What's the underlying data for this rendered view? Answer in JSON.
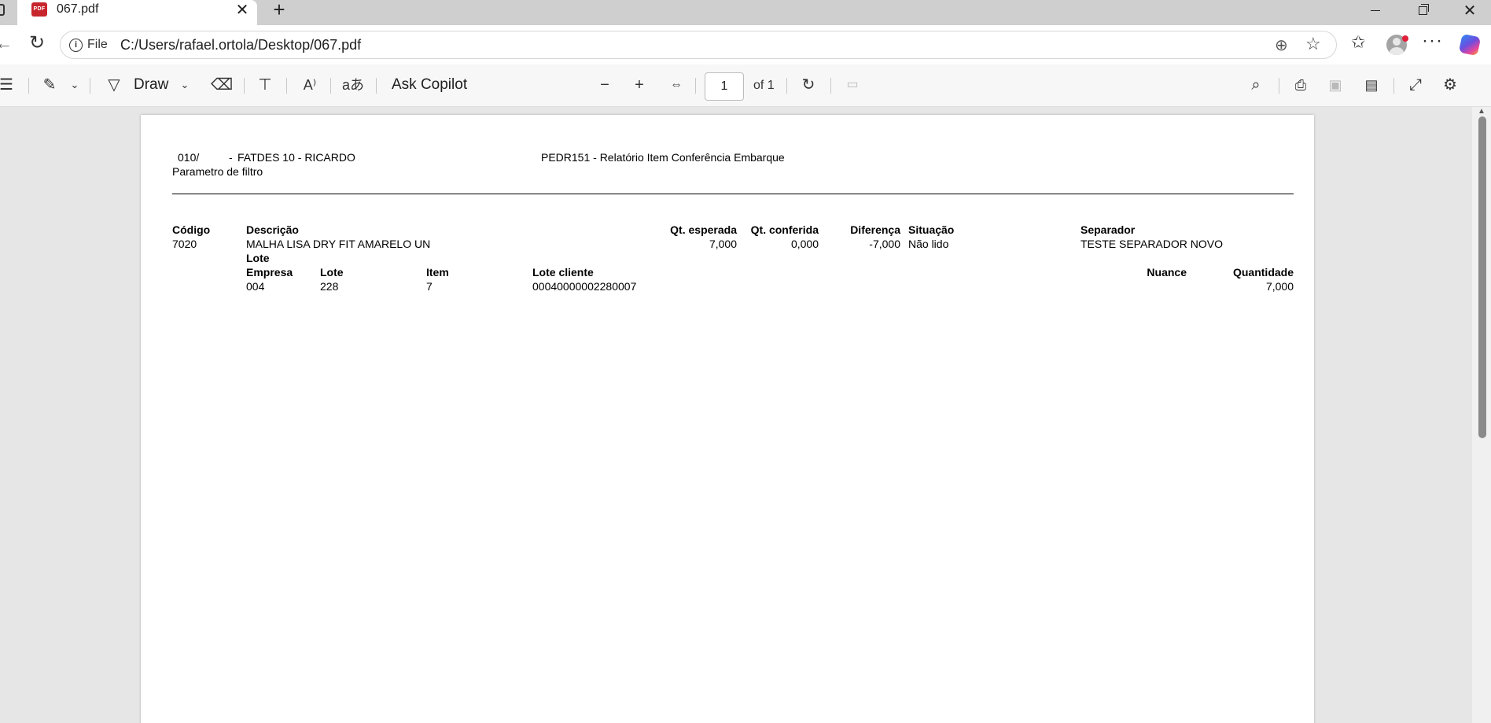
{
  "browser": {
    "tab_title": "067.pdf",
    "pdf_badge": "PDF",
    "file_label": "File",
    "url": "C:/Users/rafael.ortola/Desktop/067.pdf"
  },
  "toolbar": {
    "draw_label": "Draw",
    "ask_copilot_label": "Ask Copilot",
    "page_number": "1",
    "page_of": "of 1"
  },
  "report": {
    "header_code": "010/",
    "header_dash": "-",
    "header_name": "FATDES 10 - RICARDO",
    "report_title": "PEDR151 - Relatório Item Conferência Embarque",
    "filter_label": "Parametro de filtro",
    "columns": {
      "codigo": "Código",
      "descricao": "Descrição",
      "qt_esperada": "Qt. esperada",
      "qt_conferida": "Qt. conferida",
      "diferenca": "Diferença",
      "situacao": "Situação",
      "separador": "Separador"
    },
    "item": {
      "codigo": "7020",
      "descricao": "MALHA LISA DRY FIT AMARELO UN",
      "qt_esperada": "7,000",
      "qt_conferida": "0,000",
      "diferenca": "-7,000",
      "situacao": "Não lido",
      "separador": "TESTE SEPARADOR NOVO"
    },
    "lote_section_label": "Lote",
    "lote_columns": {
      "empresa": "Empresa",
      "lote": "Lote",
      "item": "Item",
      "lote_cliente": "Lote cliente",
      "nuance": "Nuance",
      "quantidade": "Quantidade"
    },
    "lote_row": {
      "empresa": "004",
      "lote": "228",
      "item": "7",
      "lote_cliente": "00040000002280007",
      "nuance": "",
      "quantidade": "7,000"
    }
  }
}
